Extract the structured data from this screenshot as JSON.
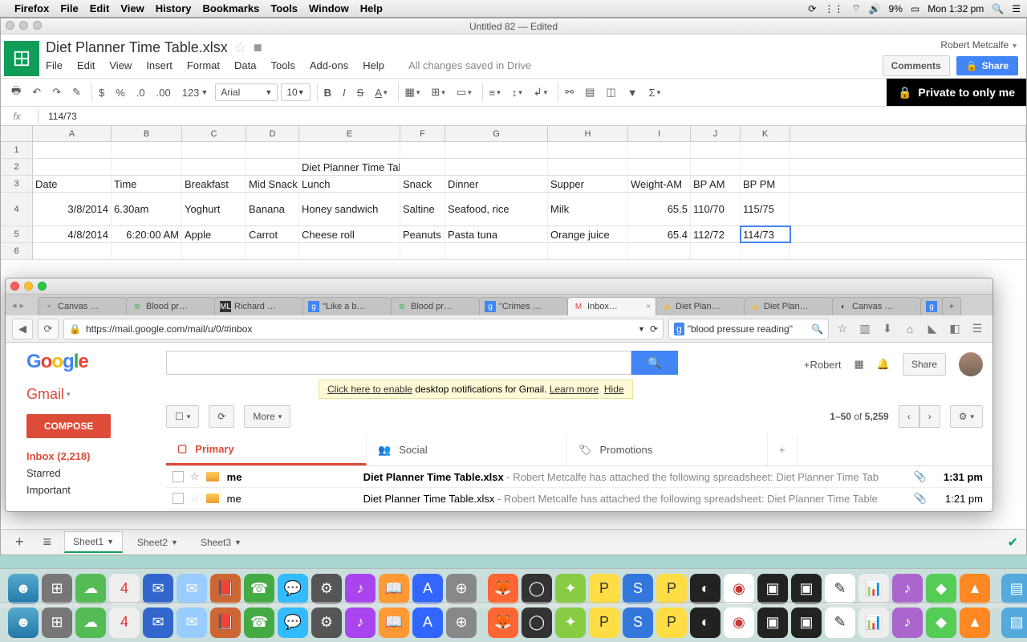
{
  "menubar": {
    "app": "Firefox",
    "items": [
      "File",
      "Edit",
      "View",
      "History",
      "Bookmarks",
      "Tools",
      "Window",
      "Help"
    ],
    "battery": "9%",
    "clock": "Mon 1:32 pm"
  },
  "sheets": {
    "window_title": "Untitled 82 — Edited",
    "doc_title": "Diet Planner Time Table.xlsx",
    "user": "Robert Metcalfe",
    "menus": [
      "File",
      "Edit",
      "View",
      "Insert",
      "Format",
      "Data",
      "Tools",
      "Add-ons",
      "Help"
    ],
    "saved": "All changes saved in Drive",
    "comments": "Comments",
    "share": "Share",
    "private": "Private to only me",
    "font": "Arial",
    "fontsize": "10",
    "fx_value": "114/73",
    "formats": [
      "$",
      "%",
      ".0",
      ".00",
      "123"
    ],
    "cols": [
      "A",
      "B",
      "C",
      "D",
      "E",
      "F",
      "G",
      "H",
      "I",
      "J",
      "K"
    ],
    "title_row": "Diet Planner Time Table",
    "headers": [
      "Date",
      "Time",
      "Breakfast",
      "Mid Snack",
      "Lunch",
      "Snack",
      "Dinner",
      "Supper",
      "Weight-AM",
      "BP AM",
      "BP PM"
    ],
    "data": [
      [
        "3/8/2014",
        "6.30am",
        "Yoghurt",
        "Banana",
        "Honey sandwich",
        "Saltine",
        "Seafood, rice",
        "Milk",
        "65.5",
        "110/70",
        "115/75"
      ],
      [
        "4/8/2014",
        "6:20:00 AM",
        "Apple",
        "Carrot",
        "Cheese roll",
        "Peanuts",
        "Pasta tuna",
        "Orange juice",
        "65.4",
        "112/72",
        "114/73"
      ]
    ],
    "sheet_tabs": [
      "Sheet1",
      "Sheet2",
      "Sheet3"
    ]
  },
  "chart_data": {
    "type": "table",
    "title": "Diet Planner Time Table",
    "columns": [
      "Date",
      "Time",
      "Breakfast",
      "Mid Snack",
      "Lunch",
      "Snack",
      "Dinner",
      "Supper",
      "Weight-AM",
      "BP AM",
      "BP PM"
    ],
    "rows": [
      {
        "Date": "3/8/2014",
        "Time": "6.30am",
        "Breakfast": "Yoghurt",
        "Mid Snack": "Banana",
        "Lunch": "Honey sandwich",
        "Snack": "Saltine",
        "Dinner": "Seafood, rice",
        "Supper": "Milk",
        "Weight-AM": 65.5,
        "BP AM": "110/70",
        "BP PM": "115/75"
      },
      {
        "Date": "4/8/2014",
        "Time": "6:20:00 AM",
        "Breakfast": "Apple",
        "Mid Snack": "Carrot",
        "Lunch": "Cheese roll",
        "Snack": "Peanuts",
        "Dinner": "Pasta tuna",
        "Supper": "Orange juice",
        "Weight-AM": 65.4,
        "BP AM": "112/72",
        "BP PM": "114/73"
      }
    ]
  },
  "gmail": {
    "url": "https://mail.google.com/mail/u/0/#inbox",
    "search_query": "\"blood pressure reading\"",
    "plus_user": "+Robert",
    "share": "Share",
    "brand": "Gmail",
    "notif": {
      "pre": "Click here to enable",
      "mid": " desktop notifications for Gmail.   ",
      "learn": "Learn more",
      "hide": "Hide"
    },
    "compose": "COMPOSE",
    "nav": [
      {
        "label": "Inbox (2,218)",
        "active": true
      },
      {
        "label": "Starred"
      },
      {
        "label": "Important"
      }
    ],
    "more": "More",
    "count_range": "1–50",
    "count_of": " of ",
    "count_total": "5,259",
    "tabs": [
      "Primary",
      "Social",
      "Promotions"
    ],
    "btabs": [
      "Canvas …",
      "Blood pr…",
      "Richard …",
      "\"Like a b…",
      "Blood pr…",
      "\"Crimes …",
      "Inbox…",
      "Diet Plan…",
      "Diet Plan…",
      "Canvas …"
    ],
    "rows": [
      {
        "from": "me",
        "subject": "Diet Planner Time Table.xlsx",
        "preview": " - Robert Metcalfe has attached the following spreadsheet: Diet Planner Time Tab",
        "time": "1:31 pm",
        "bold": true
      },
      {
        "from": "me",
        "subject": "Diet Planner Time Table.xlsx",
        "preview": " - Robert Metcalfe has attached the following spreadsheet: Diet Planner Time Table",
        "time": "1:21 pm",
        "bold": false
      }
    ]
  }
}
